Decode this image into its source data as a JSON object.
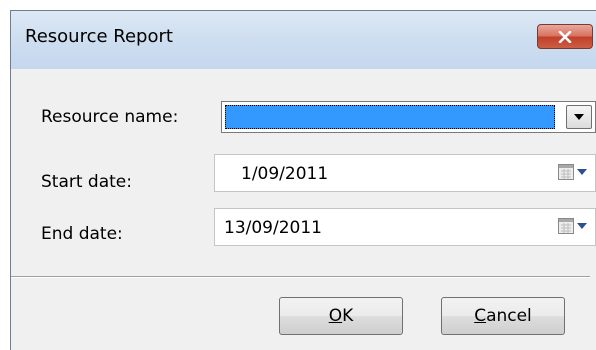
{
  "window": {
    "title": "Resource Report",
    "close_icon": "close-icon"
  },
  "form": {
    "resource_label": "Resource name:",
    "resource_value": "",
    "start_label": "Start date:",
    "start_value": "1/09/2011",
    "end_label": "End date:",
    "end_value": "13/09/2011"
  },
  "buttons": {
    "ok_mnemonic": "O",
    "ok_rest": "K",
    "cancel_mnemonic": "C",
    "cancel_rest": "ancel"
  },
  "colors": {
    "title_bar": "#cfdff0",
    "close_button": "#c9503a",
    "selection": "#3399ff",
    "dialog_bg": "#f0f0f0"
  }
}
